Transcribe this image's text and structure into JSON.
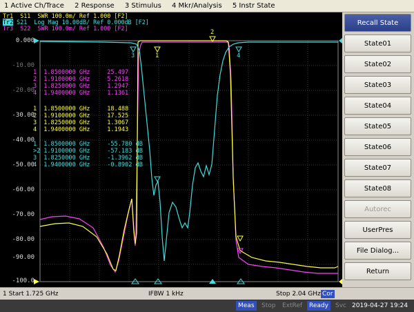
{
  "menu": [
    "1 Active Ch/Trace",
    "2 Response",
    "3 Stimulus",
    "4 Mkr/Analysis",
    "5 Instr State"
  ],
  "traces": {
    "tr1": "Tr1  S11  SWR 100.0m/ Ref 1.000 [F2]",
    "tr2_tag": "Tr2",
    "tr2": " S21  Log Mag 10.00dB/ Ref 0.000dB [F2]",
    "tr3": "Tr3  S22  SWR 100.0m/ Ref 1.000 [F2]"
  },
  "y_axis": [
    "0.000",
    "-10.00",
    "-20.00",
    "-30.00",
    "-40.00",
    "-50.00",
    "-60.00",
    "-70.00",
    "-80.00",
    "-90.00",
    "-100.0"
  ],
  "markers_s11": [
    {
      "n": "1",
      "f": "1.8500000 GHz",
      "v": "25.497"
    },
    {
      "n": "2",
      "f": "1.9100000 GHz",
      "v": "5.2618"
    },
    {
      "n": "3",
      "f": "1.8250000 GHz",
      "v": "1.2947"
    },
    {
      "n": "4",
      "f": "1.9400000 GHz",
      "v": "1.1361"
    }
  ],
  "markers_s22": [
    {
      "n": "1",
      "f": "1.8500000 GHz",
      "v": "18.488"
    },
    {
      "n": "2",
      "f": "1.9100000 GHz",
      "v": "17.525"
    },
    {
      "n": "3",
      "f": "1.8250000 GHz",
      "v": "1.3067"
    },
    {
      "n": "4",
      "f": "1.9400000 GHz",
      "v": "1.1943"
    }
  ],
  "markers_s21": [
    {
      "n": "1",
      "f": "1.8500000 GHz",
      "v": "-55.780 dB"
    },
    {
      "n": ">2",
      "f": "1.9100000 GHz",
      "v": "-57.183 dB"
    },
    {
      "n": "3",
      "f": "1.8250000 GHz",
      "v": "-1.3962 dB"
    },
    {
      "n": "4",
      "f": "1.9400000 GHz",
      "v": "-0.8902 dB"
    }
  ],
  "softkeys": [
    "Recall State",
    "State01",
    "State02",
    "State03",
    "State04",
    "State05",
    "State06",
    "State07",
    "State08",
    "Autorec",
    "UserPres",
    "File Dialog...",
    "Return"
  ],
  "status": {
    "start": "1  Start 1.725 GHz",
    "ifbw": "IFBW 1 kHz",
    "stop": "Stop 2.04 GHz",
    "cor": "Cor"
  },
  "bottom": {
    "meas": "Meas",
    "stop": "Stop",
    "extref": "ExtRef",
    "ready": "Ready",
    "svc": "Svc",
    "datetime": "2019-04-27 19:24"
  },
  "colors": {
    "s11": "#ffff40",
    "s21": "#40e0e0",
    "s22": "#ff40ff"
  },
  "trace_marker_labels": {
    "m1": "1",
    "m2": "2",
    "m3": "3",
    "m4": "4"
  }
}
